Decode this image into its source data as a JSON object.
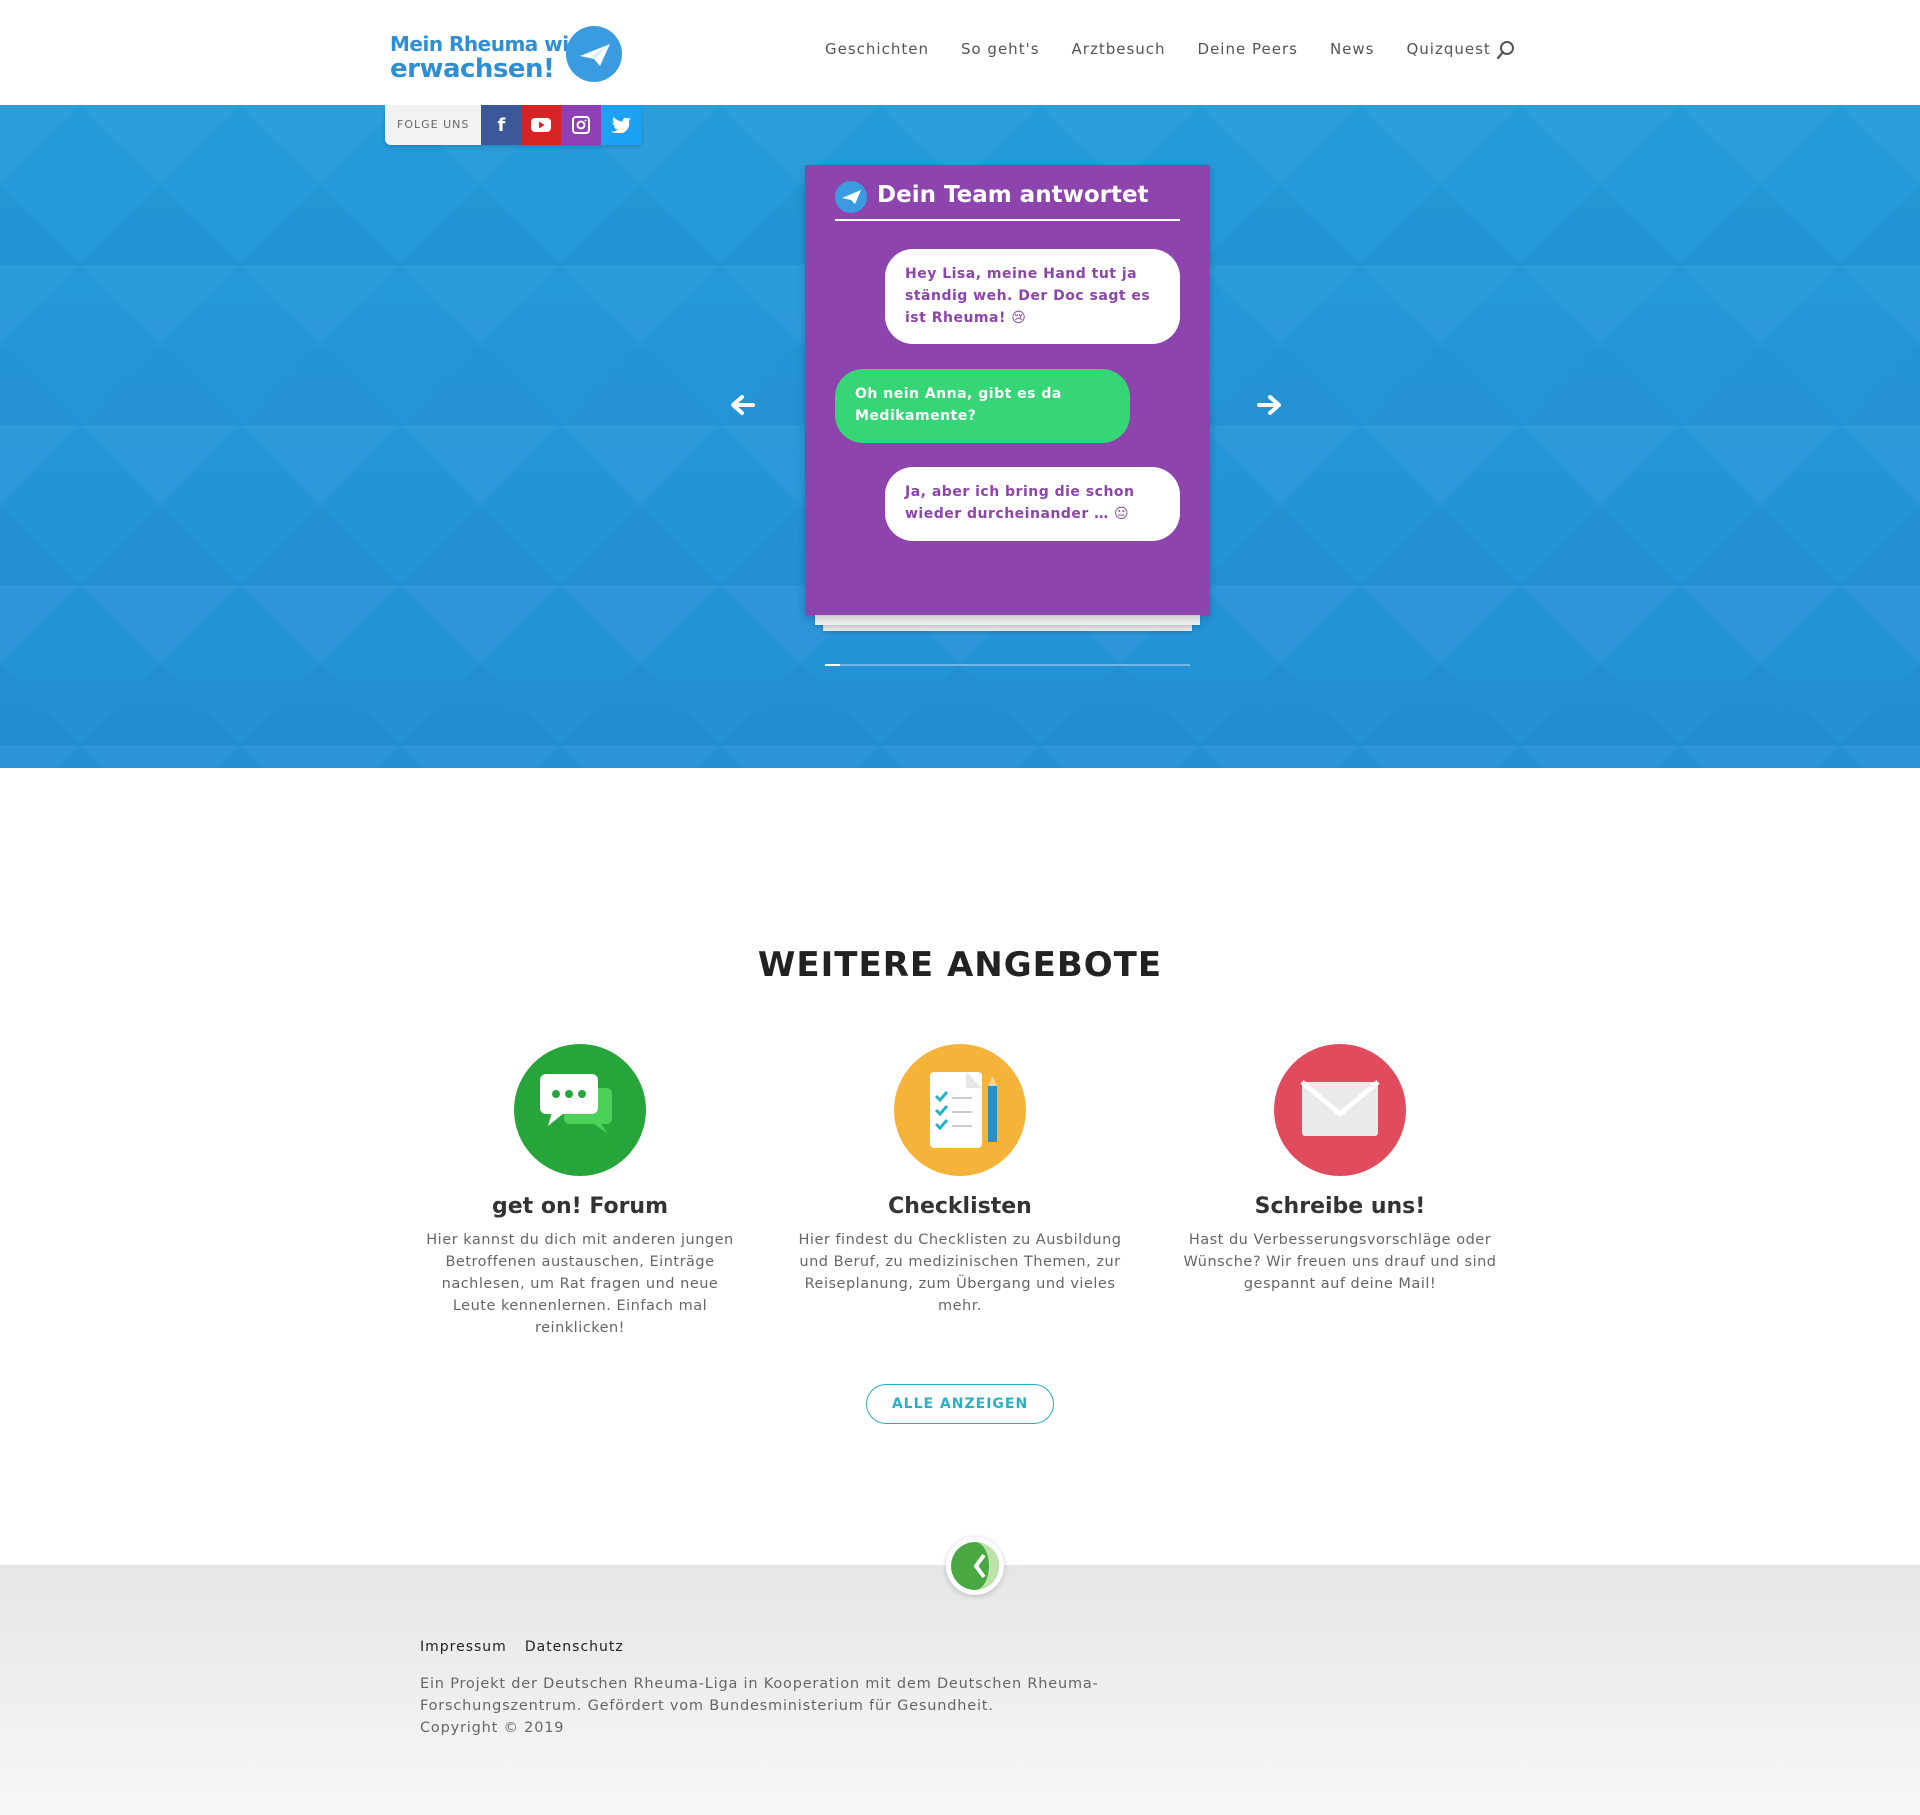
{
  "header": {
    "logo": {
      "line1": "Mein Rheuma wird",
      "line2": "erwachsen!"
    },
    "nav": [
      "Geschichten",
      "So geht's",
      "Arztbesuch",
      "Deine Peers",
      "News",
      "Quizquest"
    ]
  },
  "follow": {
    "label": "FOLGE UNS"
  },
  "chat": {
    "title": "Dein Team antwortet",
    "messages": [
      {
        "side": "out",
        "text": "Hey Lisa, meine Hand tut ja ständig weh. Der Doc sagt es ist Rheuma! 😢"
      },
      {
        "side": "in",
        "text": "Oh nein Anna, gibt es da Medikamente?"
      },
      {
        "side": "out",
        "text": "Ja, aber ich bring die schon wieder durcheinander … 😐"
      }
    ],
    "progress": 0.04
  },
  "offers": {
    "title": "WEITERE ANGEBOTE",
    "items": [
      {
        "title": "get on! Forum",
        "text": "Hier kannst du dich mit anderen jungen Betroffenen austauschen, Einträge nachlesen, um Rat fragen und neue Leute kennenlernen. Einfach mal reinklicken!",
        "color": "#27a43a"
      },
      {
        "title": "Checklisten",
        "text": "Hier findest du Checklisten zu Ausbildung und Beruf, zu medizinischen Themen, zur Reiseplanung, zum Übergang und vieles mehr.",
        "color": "#f6b33a"
      },
      {
        "title": "Schreibe uns!",
        "text": "Hast du Verbesserungsvorschläge oder Wünsche? Wir freuen uns drauf und sind gespannt auf deine Mail!",
        "color": "#e04b5d"
      }
    ],
    "button": "ALLE ANZEIGEN"
  },
  "footer": {
    "links": [
      "Impressum",
      "Datenschutz"
    ],
    "text1": "Ein Projekt der Deutschen Rheuma-Liga in Kooperation mit dem Deutschen Rheuma-Forschungszentrum. Gefördert vom Bundesministerium für Gesundheit.",
    "copyright": "Copyright © 2019"
  },
  "colors": {
    "hero": "#2596d8",
    "card": "#8e44ad",
    "bubble_in": "#36d576",
    "accent": "#2ab0c4"
  }
}
